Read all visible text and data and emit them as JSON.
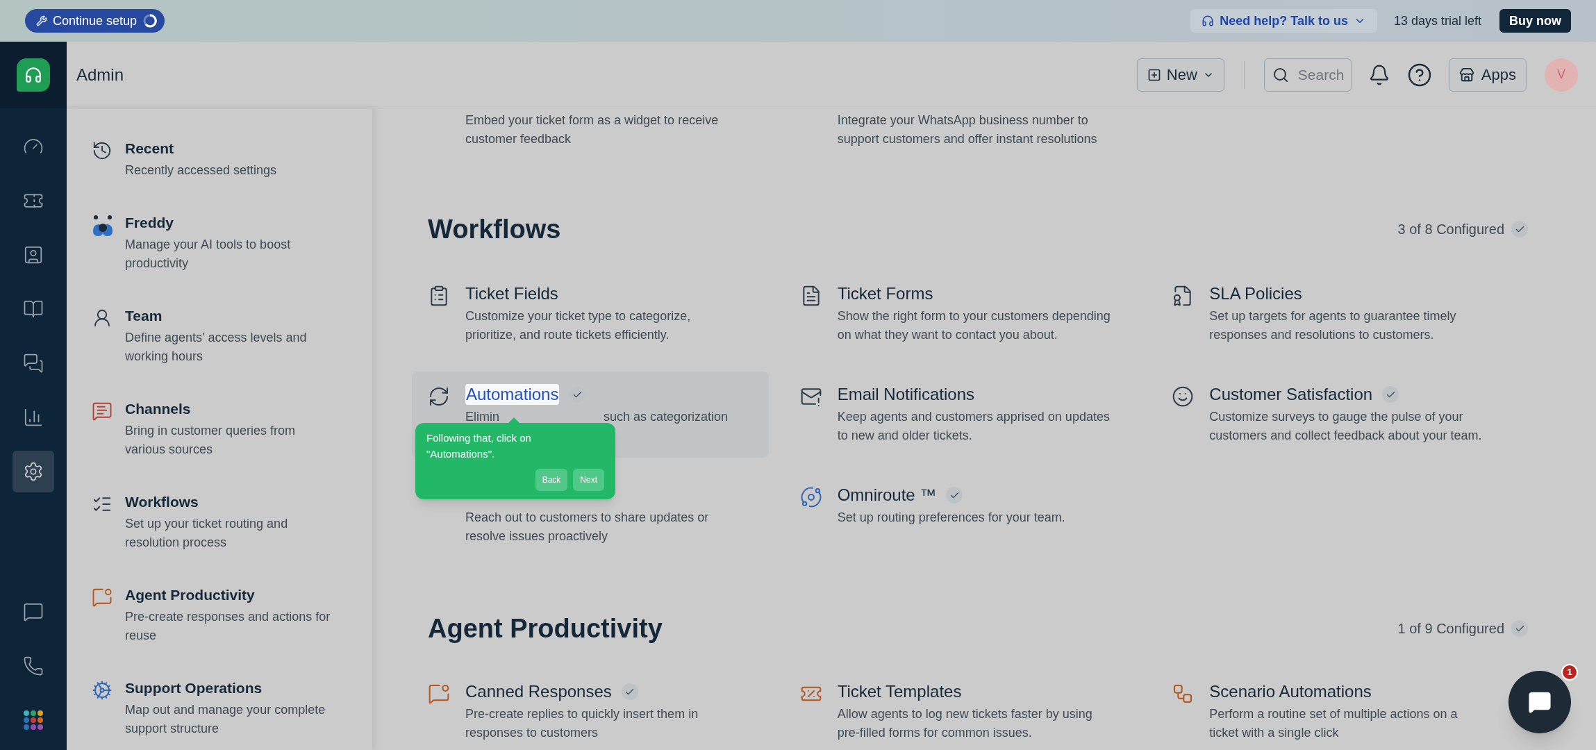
{
  "banner": {
    "setup": "Continue setup",
    "help": "Need help? Talk to us",
    "trial": "13 days trial left",
    "buy": "Buy now"
  },
  "header": {
    "title": "Admin",
    "new": "New",
    "search": {
      "placeholder": "Search"
    },
    "apps": "Apps",
    "avatar": "V"
  },
  "rail": [
    {
      "selected": false
    },
    {
      "selected": false
    },
    {
      "selected": false
    },
    {
      "selected": false
    },
    {
      "selected": false
    },
    {
      "selected": false
    },
    {
      "selected": true
    }
  ],
  "settings_nav": [
    {
      "title": "Recent",
      "description": "Recently accessed settings"
    },
    {
      "title": "Freddy",
      "description": "Manage your AI tools to boost productivity"
    },
    {
      "title": "Team",
      "description": "Define agents' access levels and working hours"
    },
    {
      "title": "Channels",
      "description": "Bring in customer queries from various sources"
    },
    {
      "title": "Workflows",
      "description": "Set up your ticket routing and resolution process"
    },
    {
      "title": "Agent Productivity",
      "description": "Pre-create responses and actions for reuse"
    },
    {
      "title": "Support Operations",
      "description": "Map out and manage your complete support structure"
    }
  ],
  "partial_row": [
    "Embed your ticket form as a widget to receive customer feedback",
    "Integrate your WhatsApp business number to support customers and offer instant resolutions"
  ],
  "sections": [
    {
      "title": "Workflows",
      "configured": "3 of 8 Configured",
      "items": [
        {
          "title": "Ticket Fields",
          "description": [
            "Customize your ticket type to categorize, prioritize, and route tickets efficiently."
          ],
          "configured": false,
          "highlighted": false
        },
        {
          "title": "Ticket Forms",
          "description": [
            "Show the right form to your customers depending on what they want to contact you about."
          ],
          "configured": false,
          "highlighted": false
        },
        {
          "title": "SLA Policies",
          "description": [
            "Set up targets for agents to guarantee timely responses and resolutions to customers."
          ],
          "configured": false,
          "highlighted": false
        },
        {
          "title": "Automations",
          "description": [
            "Elimin",
            "such as categorization"
          ],
          "configured": true,
          "highlighted": true
        },
        {
          "title": "Email Notifications",
          "description": [
            "Keep agents and customers apprised on updates to new and older tickets."
          ],
          "configured": false,
          "highlighted": false
        },
        {
          "title": "Customer Satisfaction",
          "description": [
            "Customize surveys to gauge the pulse of your customers and collect feedback about your team."
          ],
          "configured": true,
          "highlighted": false
        },
        {
          "description": [
            "Reach out to customers to share updates or resolve issues proactively"
          ],
          "highlighted": false
        },
        {
          "title": "Omniroute ™",
          "description": [
            "Set up routing preferences for your team."
          ],
          "configured": true,
          "highlighted": false
        }
      ]
    },
    {
      "title": "Agent Productivity",
      "configured": "1 of 9 Configured",
      "items": [
        {
          "title": "Canned Responses",
          "description": [
            "Pre-create replies to quickly insert them in responses to customers"
          ],
          "configured": true,
          "highlighted": false
        },
        {
          "title": "Ticket Templates",
          "description": [
            "Allow agents to log new tickets faster by using pre-filled forms for common issues."
          ],
          "configured": false,
          "highlighted": false
        },
        {
          "title": "Scenario Automations",
          "description": [
            "Perform a routine set of multiple actions on a ticket with a single click"
          ],
          "configured": false,
          "highlighted": false
        }
      ]
    }
  ],
  "tour": {
    "text": "Following that, click on \"Automations\".",
    "buttons": [
      "Back",
      "Next"
    ]
  },
  "chat_widget": {
    "badge": "1"
  }
}
